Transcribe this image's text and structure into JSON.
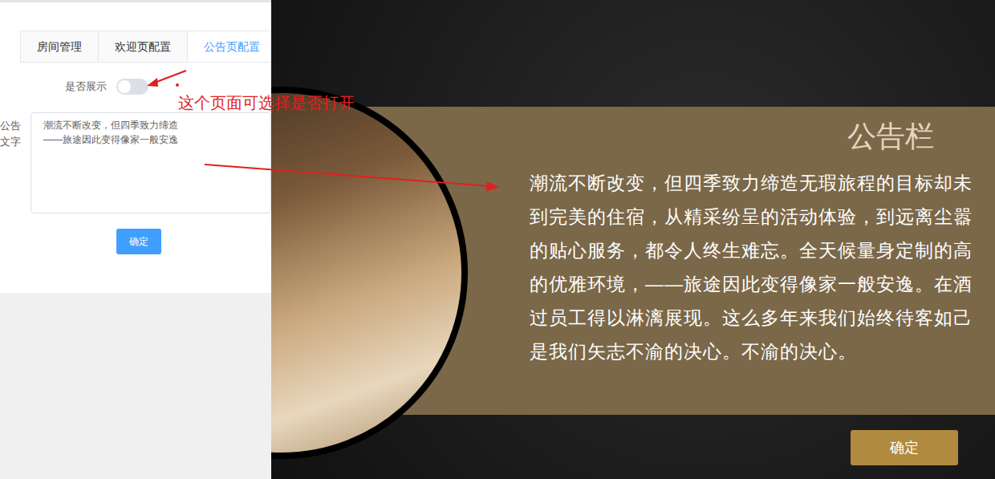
{
  "tabs": [
    {
      "label": "房间管理",
      "selected": false
    },
    {
      "label": "欢迎页配置",
      "selected": false
    },
    {
      "label": "公告页配置",
      "selected": true
    }
  ],
  "form": {
    "switch": {
      "label": "是否展示",
      "on": false
    },
    "text_label": "公告文字",
    "text_lines": [
      "潮流不断改变，但四季致力缔造",
      "——旅途因此变得像家一般安逸"
    ],
    "submit": "确定"
  },
  "annotation": "这个页面可选择是否打开",
  "preview": {
    "title": "公告栏",
    "lines": [
      "潮流不断改变，但四季致力缔造无瑕旅程的目标却未",
      "到完美的住宿，从精采纷呈的活动体验，到远离尘嚣",
      "的贴心服务，都令人终生难忘。全天候量身定制的高",
      "的优雅环境，——旅途因此变得像家一般安逸。在酒",
      "过员工得以淋漓展现。这么多年来我们始终待客如己",
      "是我们矢志不渝的决心。不渝的决心。"
    ],
    "button": "确定"
  }
}
